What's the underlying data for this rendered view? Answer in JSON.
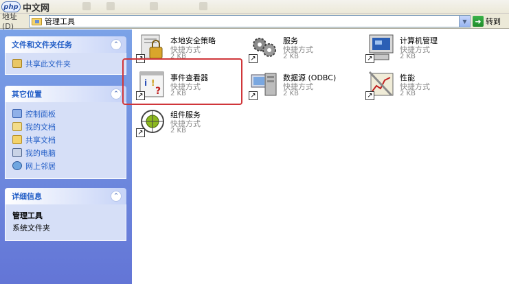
{
  "watermark": {
    "logo": "php",
    "text": "中文网"
  },
  "address": {
    "label": "地址(D)",
    "path": "管理工具",
    "go_label": "转到"
  },
  "panels": {
    "tasks": {
      "title": "文件和文件夹任务",
      "items": [
        {
          "label": "共享此文件夹",
          "icon": "share-folder-icon"
        }
      ]
    },
    "places": {
      "title": "其它位置",
      "items": [
        {
          "label": "控制面板",
          "icon": "control-panel-icon"
        },
        {
          "label": "我的文档",
          "icon": "my-documents-icon"
        },
        {
          "label": "共享文档",
          "icon": "shared-documents-icon"
        },
        {
          "label": "我的电脑",
          "icon": "my-computer-icon"
        },
        {
          "label": "网上邻居",
          "icon": "network-places-icon"
        }
      ]
    },
    "details": {
      "title": "详细信息",
      "name": "管理工具",
      "type": "系统文件夹"
    }
  },
  "files": [
    {
      "name": "本地安全策略",
      "type": "快捷方式",
      "size": "2 KB",
      "icon": "local-security-policy-icon"
    },
    {
      "name": "服务",
      "type": "快捷方式",
      "size": "2 KB",
      "icon": "services-icon"
    },
    {
      "name": "计算机管理",
      "type": "快捷方式",
      "size": "2 KB",
      "icon": "computer-management-icon"
    },
    {
      "name": "事件查看器",
      "type": "快捷方式",
      "size": "2 KB",
      "icon": "event-viewer-icon"
    },
    {
      "name": "数据源 (ODBC)",
      "type": "快捷方式",
      "size": "2 KB",
      "icon": "odbc-icon"
    },
    {
      "name": "性能",
      "type": "快捷方式",
      "size": "2 KB",
      "icon": "performance-icon"
    },
    {
      "name": "组件服务",
      "type": "快捷方式",
      "size": "2 KB",
      "icon": "component-services-icon"
    }
  ],
  "colors": {
    "highlight": "#d0363a",
    "taskpane_top": "#7ba2e7",
    "taskpane_bottom": "#6375d6",
    "link": "#215dc6"
  }
}
